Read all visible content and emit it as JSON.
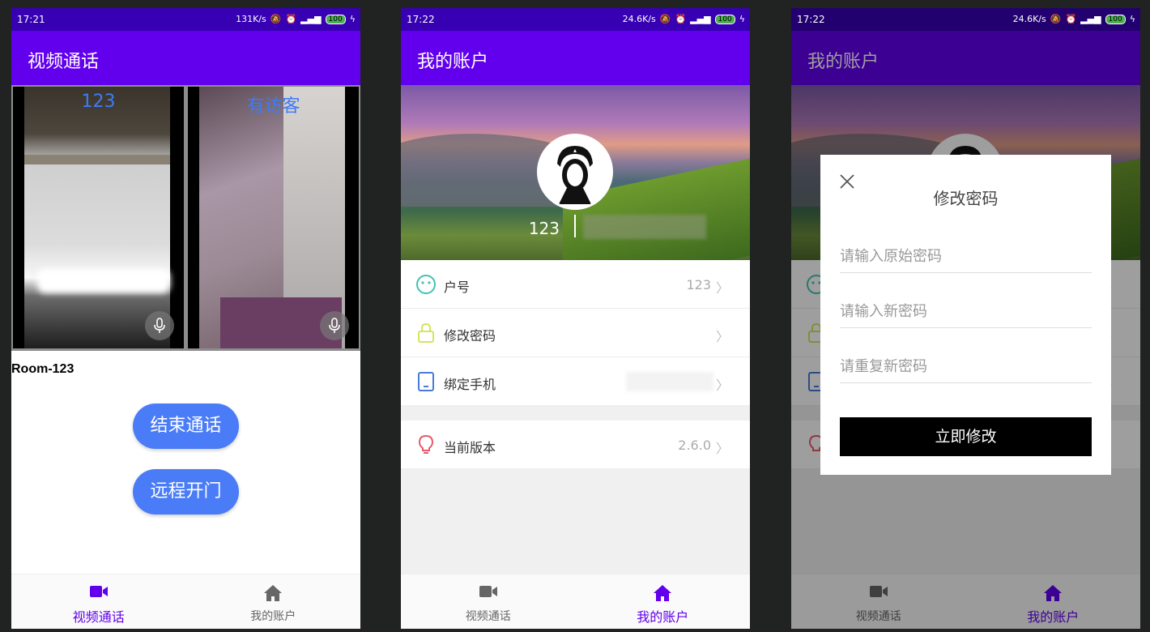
{
  "phone1": {
    "status": {
      "time": "17:21",
      "speed": "131K/s",
      "battery": "100"
    },
    "title": "视频通话",
    "video_left_name": "123",
    "video_right_name": "有访客",
    "room_label": "Room-123",
    "end_call_label": "结束通话",
    "open_door_label": "远程开门",
    "nav": {
      "video_label": "视频通话",
      "account_label": "我的账户",
      "active": "video"
    }
  },
  "phone2": {
    "status": {
      "time": "17:22",
      "speed": "24.6K/s",
      "battery": "100"
    },
    "title": "我的账户",
    "username": "123",
    "rows": [
      {
        "label": "户号",
        "value": "123",
        "icon": "face-icon"
      },
      {
        "label": "修改密码",
        "value": "",
        "icon": "lock-icon"
      },
      {
        "label": "绑定手机",
        "value": "",
        "icon": "phone-icon"
      },
      {
        "label": "当前版本",
        "value": "2.6.0",
        "icon": "bulb-icon"
      }
    ],
    "nav": {
      "video_label": "视频通话",
      "account_label": "我的账户",
      "active": "account"
    }
  },
  "phone3": {
    "status": {
      "time": "17:22",
      "speed": "24.6K/s",
      "battery": "100"
    },
    "title": "我的账户",
    "dialog": {
      "title": "修改密码",
      "old_placeholder": "请输入原始密码",
      "new_placeholder": "请输入新密码",
      "repeat_placeholder": "请重复新密码",
      "submit_label": "立即修改"
    },
    "nav": {
      "video_label": "视频通话",
      "account_label": "我的账户",
      "active": "account"
    }
  },
  "colors": {
    "primary": "#6200ee",
    "primary_dark": "#3700b3",
    "button_blue": "#4a7cf8"
  }
}
